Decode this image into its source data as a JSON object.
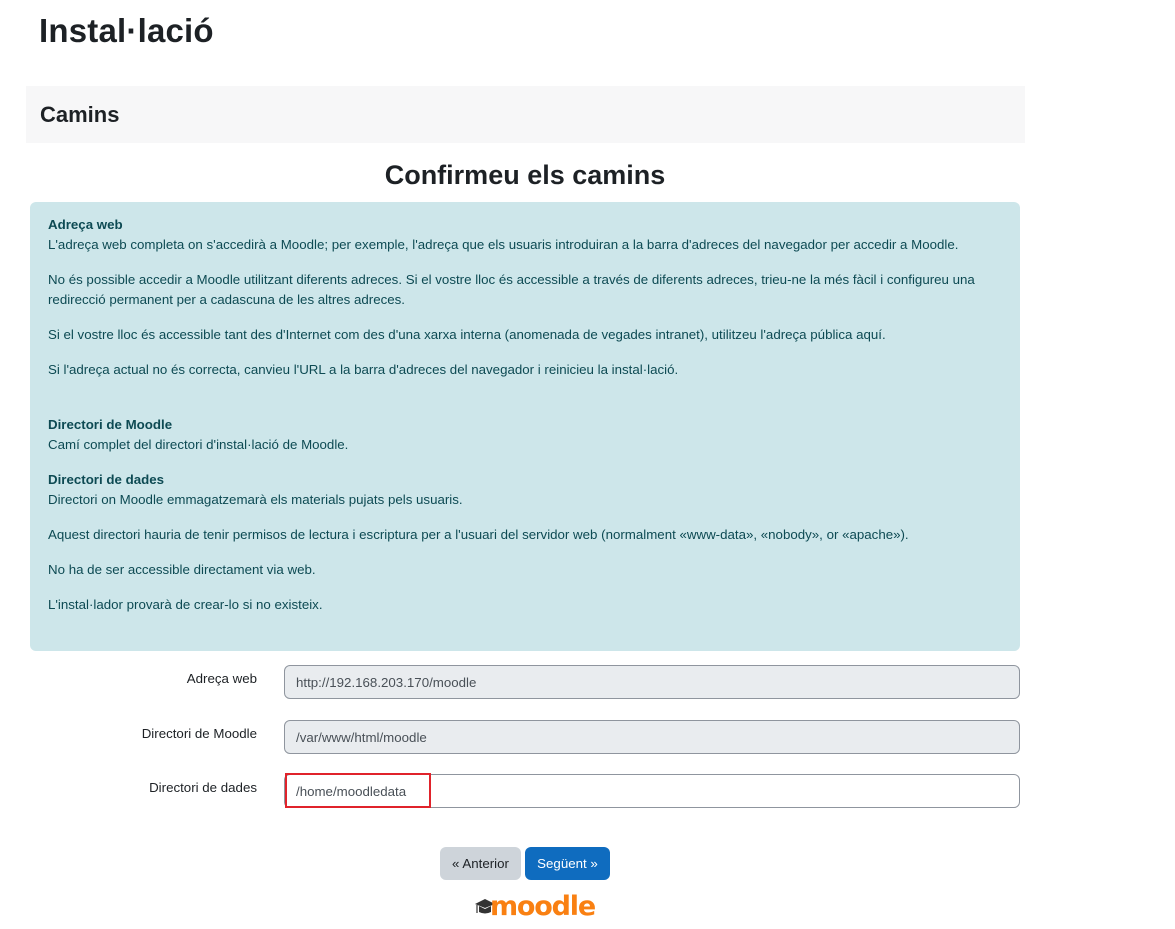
{
  "page": {
    "title": "Instal·lació"
  },
  "section": {
    "title": "Camins"
  },
  "confirm": {
    "heading": "Confirmeu els camins"
  },
  "info": {
    "web": {
      "term": "Adreça web",
      "paragraphs": [
        "L'adreça web completa on s'accedirà a Moodle; per exemple, l'adreça que els usuaris introduiran a la barra d'adreces del navegador per accedir a Moodle.",
        "No és possible accedir a Moodle utilitzant diferents adreces. Si el vostre lloc és accessible a través de diferents adreces, trieu-ne la més fàcil i configureu una redirecció permanent per a cadascuna de les altres adreces.",
        "Si el vostre lloc és accessible tant des d'Internet com des d'una xarxa interna (anomenada de vegades intranet), utilitzeu l'adreça pública aquí.",
        "Si l'adreça actual no és correcta, canvieu l'URL a la barra d'adreces del navegador i reinicieu la instal·lació."
      ]
    },
    "moodle_dir": {
      "term": "Directori de Moodle",
      "paragraphs": [
        "Camí complet del directori d'instal·lació de Moodle."
      ]
    },
    "data_dir": {
      "term": "Directori de dades",
      "paragraphs": [
        "Directori on Moodle emmagatzemarà els materials pujats pels usuaris.",
        "Aquest directori hauria de tenir permisos de lectura i escriptura per a l'usuari del servidor web (normalment «www-data», «nobody», or «apache»).",
        "No ha de ser accessible directament via web.",
        "L'instal·lador provarà de crear-lo si no existeix."
      ]
    }
  },
  "form": {
    "wwwroot": {
      "label": "Adreça web",
      "value": "http://192.168.203.170/moodle"
    },
    "dirroot": {
      "label": "Directori de Moodle",
      "value": "/var/www/html/moodle"
    },
    "dataroot": {
      "label": "Directori de dades",
      "value": "/home/moodledata"
    }
  },
  "buttons": {
    "previous": "« Anterior",
    "next": "Següent »"
  },
  "logo": {
    "text": "moodle"
  },
  "colors": {
    "info_bg": "#cde6ea",
    "info_text": "#0d4a53",
    "primary": "#0f6cbf",
    "secondary": "#ced4da",
    "highlight": "#e0232b",
    "logo": "#f98012"
  }
}
